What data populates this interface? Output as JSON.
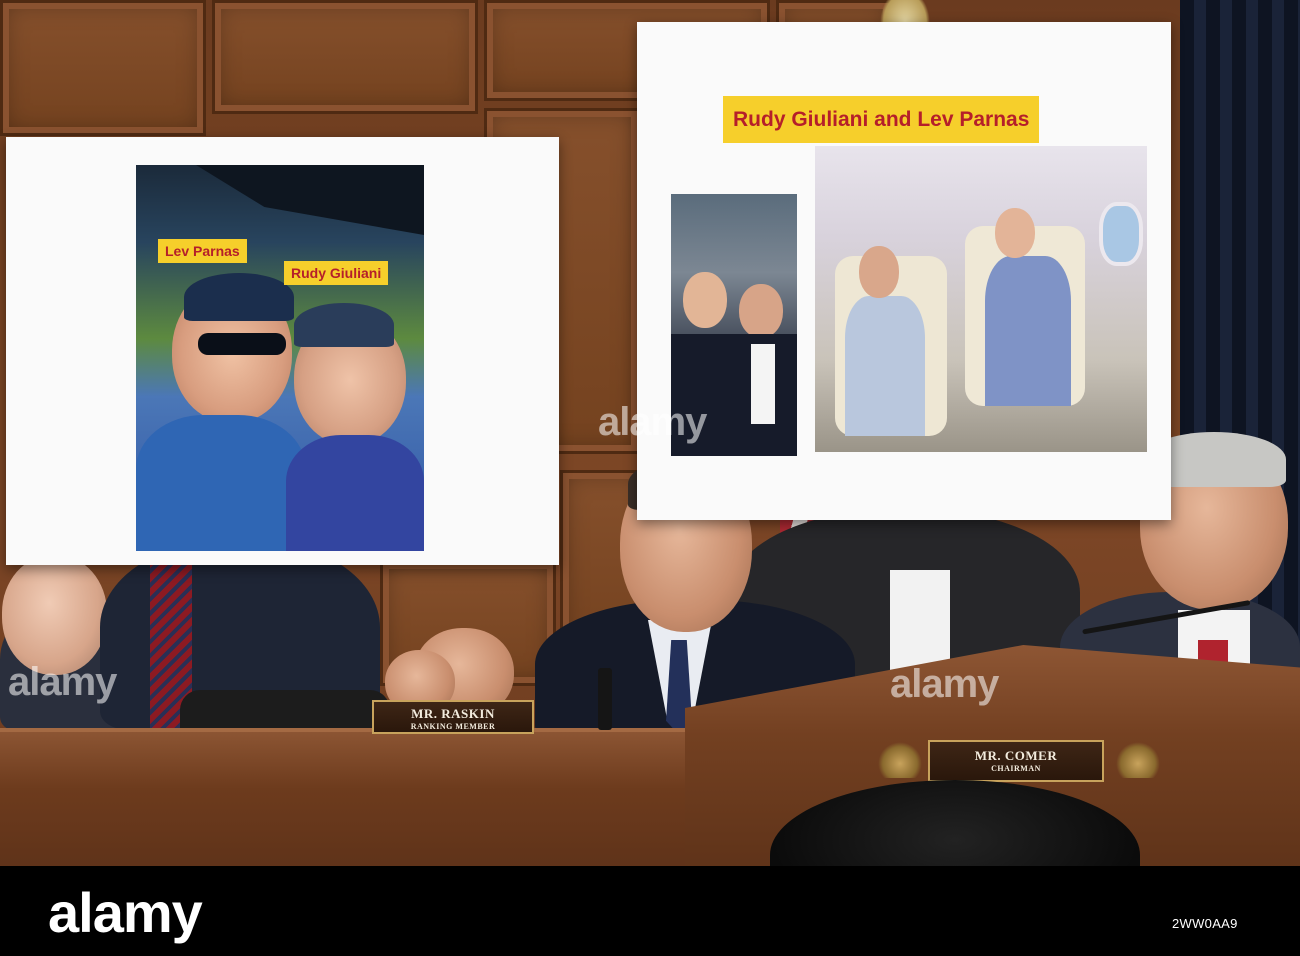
{
  "left_poster": {
    "label_1": "Lev Parnas",
    "label_2": "Rudy Giuliani"
  },
  "right_poster": {
    "title": "Rudy Giuliani and Lev Parnas"
  },
  "nameplates": {
    "raskin_name": "MR. RASKIN",
    "raskin_title": "RANKING MEMBER",
    "comer_name": "MR. COMER",
    "comer_title": "CHAIRMAN"
  },
  "watermark": {
    "logo": "alamy",
    "image_id": "2WW0AA9"
  },
  "colors": {
    "label_bg": "#f6cf2b",
    "label_text": "#b51f2a",
    "wood": "#7a4523"
  }
}
